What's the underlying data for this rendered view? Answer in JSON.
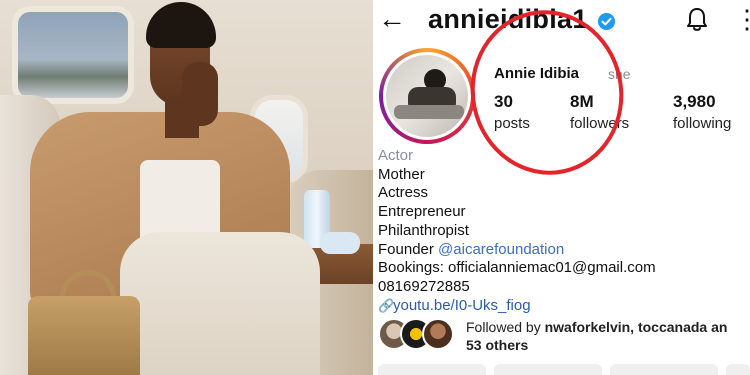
{
  "profile": {
    "username": "annieidibia1",
    "display_name": "Annie Idibia",
    "pronoun": "she",
    "stats": [
      {
        "value": "30",
        "label": "posts"
      },
      {
        "value": "8M",
        "label": "followers"
      },
      {
        "value": "3,980",
        "label": "following"
      }
    ],
    "bio": {
      "category": "Actor",
      "lines": [
        "Mother",
        "Actress",
        "Entrepreneur",
        "Philanthropist"
      ],
      "founder_prefix": "Founder",
      "founder_mention": "@aicarefoundation",
      "bookings": "Bookings: officialanniemac01@gmail.com",
      "phone": "08169272885",
      "link": "youtu.be/I0-Uks_fiog"
    },
    "followed_by": {
      "prefix": "Followed by",
      "names": "nwaforkelvin, toccanada an",
      "others": "53 others"
    }
  },
  "icons": {
    "back": "back-arrow-icon",
    "verified": "verified-badge-icon",
    "notifications": "bell-icon",
    "more": "more-options-icon",
    "link": "link-icon"
  },
  "colors": {
    "verified": "#1d9bf0",
    "annotation_circle": "#e3242b",
    "mention": "#3b6fc4",
    "category": "#8a8f99"
  }
}
